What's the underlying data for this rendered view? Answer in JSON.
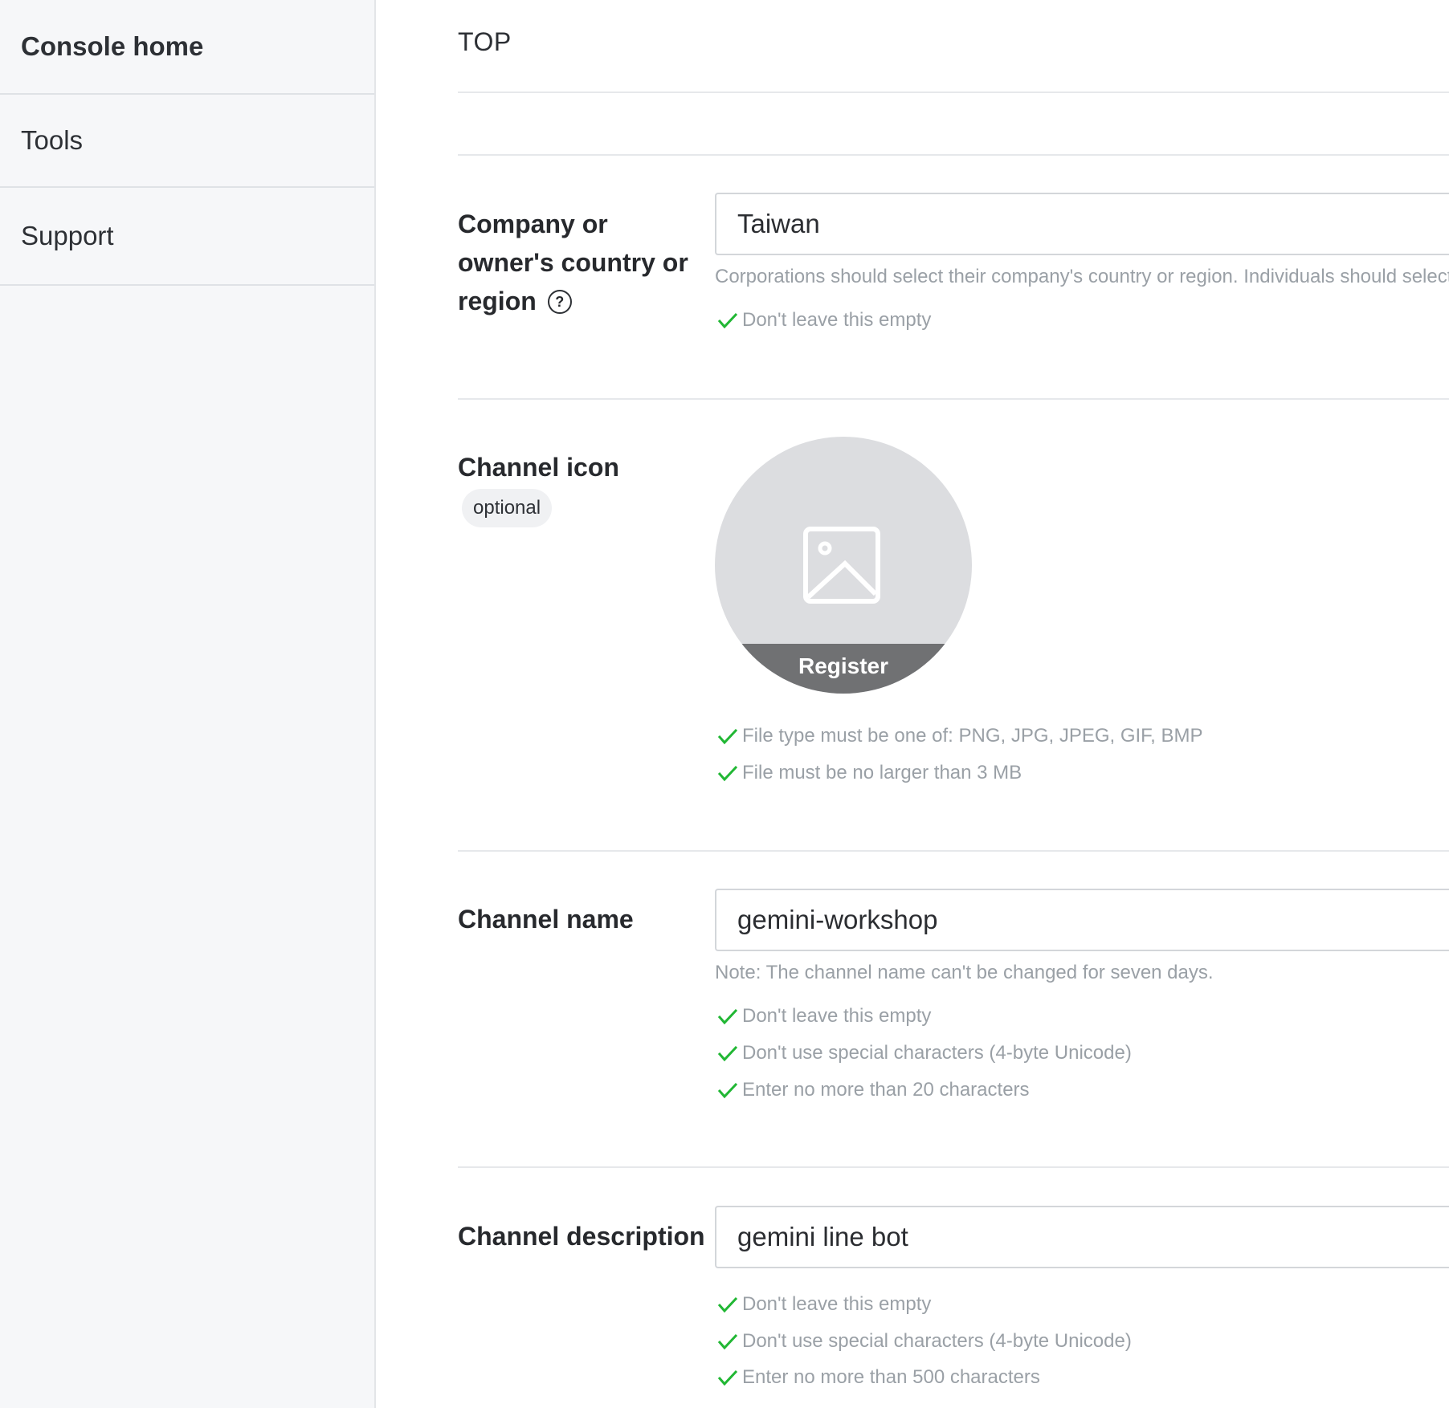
{
  "sidebar": {
    "items": [
      {
        "label": "Console home"
      },
      {
        "label": "Tools"
      },
      {
        "label": "Support"
      }
    ]
  },
  "breadcrumb": "TOP",
  "fields": {
    "country": {
      "label": "Company or owner's country or region",
      "value": "Taiwan",
      "hint": "Corporations should select their company's country or region. Individuals should select",
      "checks": [
        "Don't leave this empty"
      ]
    },
    "icon": {
      "label": "Channel icon",
      "badge": "optional",
      "register_label": "Register",
      "checks": [
        "File type must be one of: PNG, JPG, JPEG, GIF, BMP",
        "File must be no larger than 3 MB"
      ]
    },
    "name": {
      "label": "Channel name",
      "value": "gemini-workshop",
      "hint": "Note: The channel name can't be changed for seven days.",
      "checks": [
        "Don't leave this empty",
        "Don't use special characters (4-byte Unicode)",
        "Enter no more than 20 characters"
      ]
    },
    "description": {
      "label": "Channel description",
      "value": "gemini line bot",
      "checks": [
        "Don't leave this empty",
        "Don't use special characters (4-byte Unicode)",
        "Enter no more than 500 characters"
      ]
    }
  },
  "colors": {
    "check": "#21b734",
    "sidebar_bg": "#f6f7f9",
    "hint_text": "#9aa0a6"
  },
  "icons": [
    "help-circle-icon",
    "image-placeholder-icon",
    "check-icon"
  ]
}
